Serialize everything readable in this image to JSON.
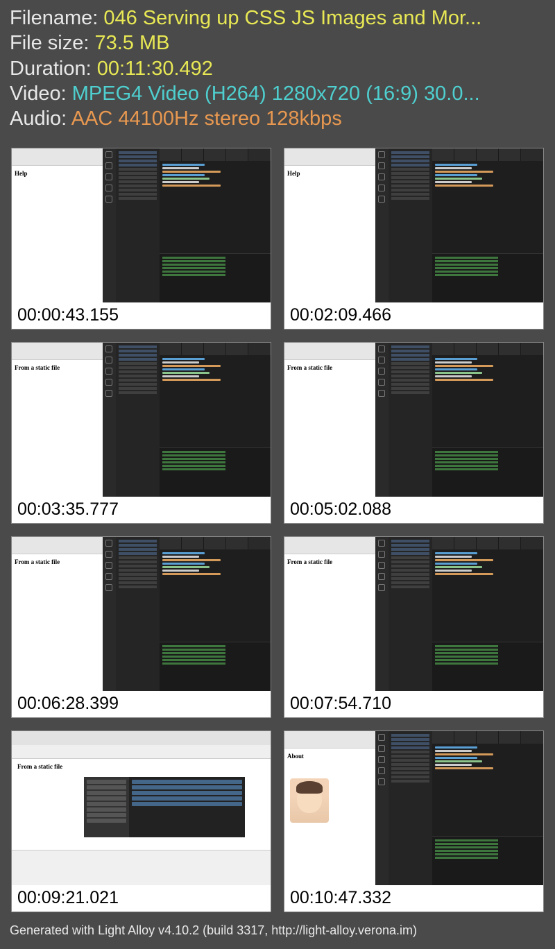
{
  "header": {
    "filename_label": "Filename: ",
    "filename_value": "046 Serving up CSS JS Images and Mor...",
    "filesize_label": "File size: ",
    "filesize_value": "73.5 MB",
    "duration_label": "Duration: ",
    "duration_value": "00:11:30.492",
    "video_label": "Video: ",
    "video_value": "MPEG4 Video (H264) 1280x720 (16:9) 30.0...",
    "audio_label": "Audio: ",
    "audio_value": "AAC 44100Hz stereo 128kbps"
  },
  "thumbs": [
    {
      "ts": "00:00:43.155",
      "browser_text": "Help",
      "layout": "ide"
    },
    {
      "ts": "00:02:09.466",
      "browser_text": "Help",
      "layout": "ide"
    },
    {
      "ts": "00:03:35.777",
      "browser_text": "From a static file",
      "layout": "ide"
    },
    {
      "ts": "00:05:02.088",
      "browser_text": "From a static file",
      "layout": "ide"
    },
    {
      "ts": "00:06:28.399",
      "browser_text": "From a static file",
      "layout": "ide"
    },
    {
      "ts": "00:07:54.710",
      "browser_text": "From a static file",
      "layout": "ide"
    },
    {
      "ts": "00:09:21.021",
      "browser_text": "From a static file",
      "layout": "finder"
    },
    {
      "ts": "00:10:47.332",
      "browser_text": "About",
      "layout": "ide-avatar"
    }
  ],
  "footer": "Generated with Light Alloy v4.10.2 (build 3317, http://light-alloy.verona.im)"
}
